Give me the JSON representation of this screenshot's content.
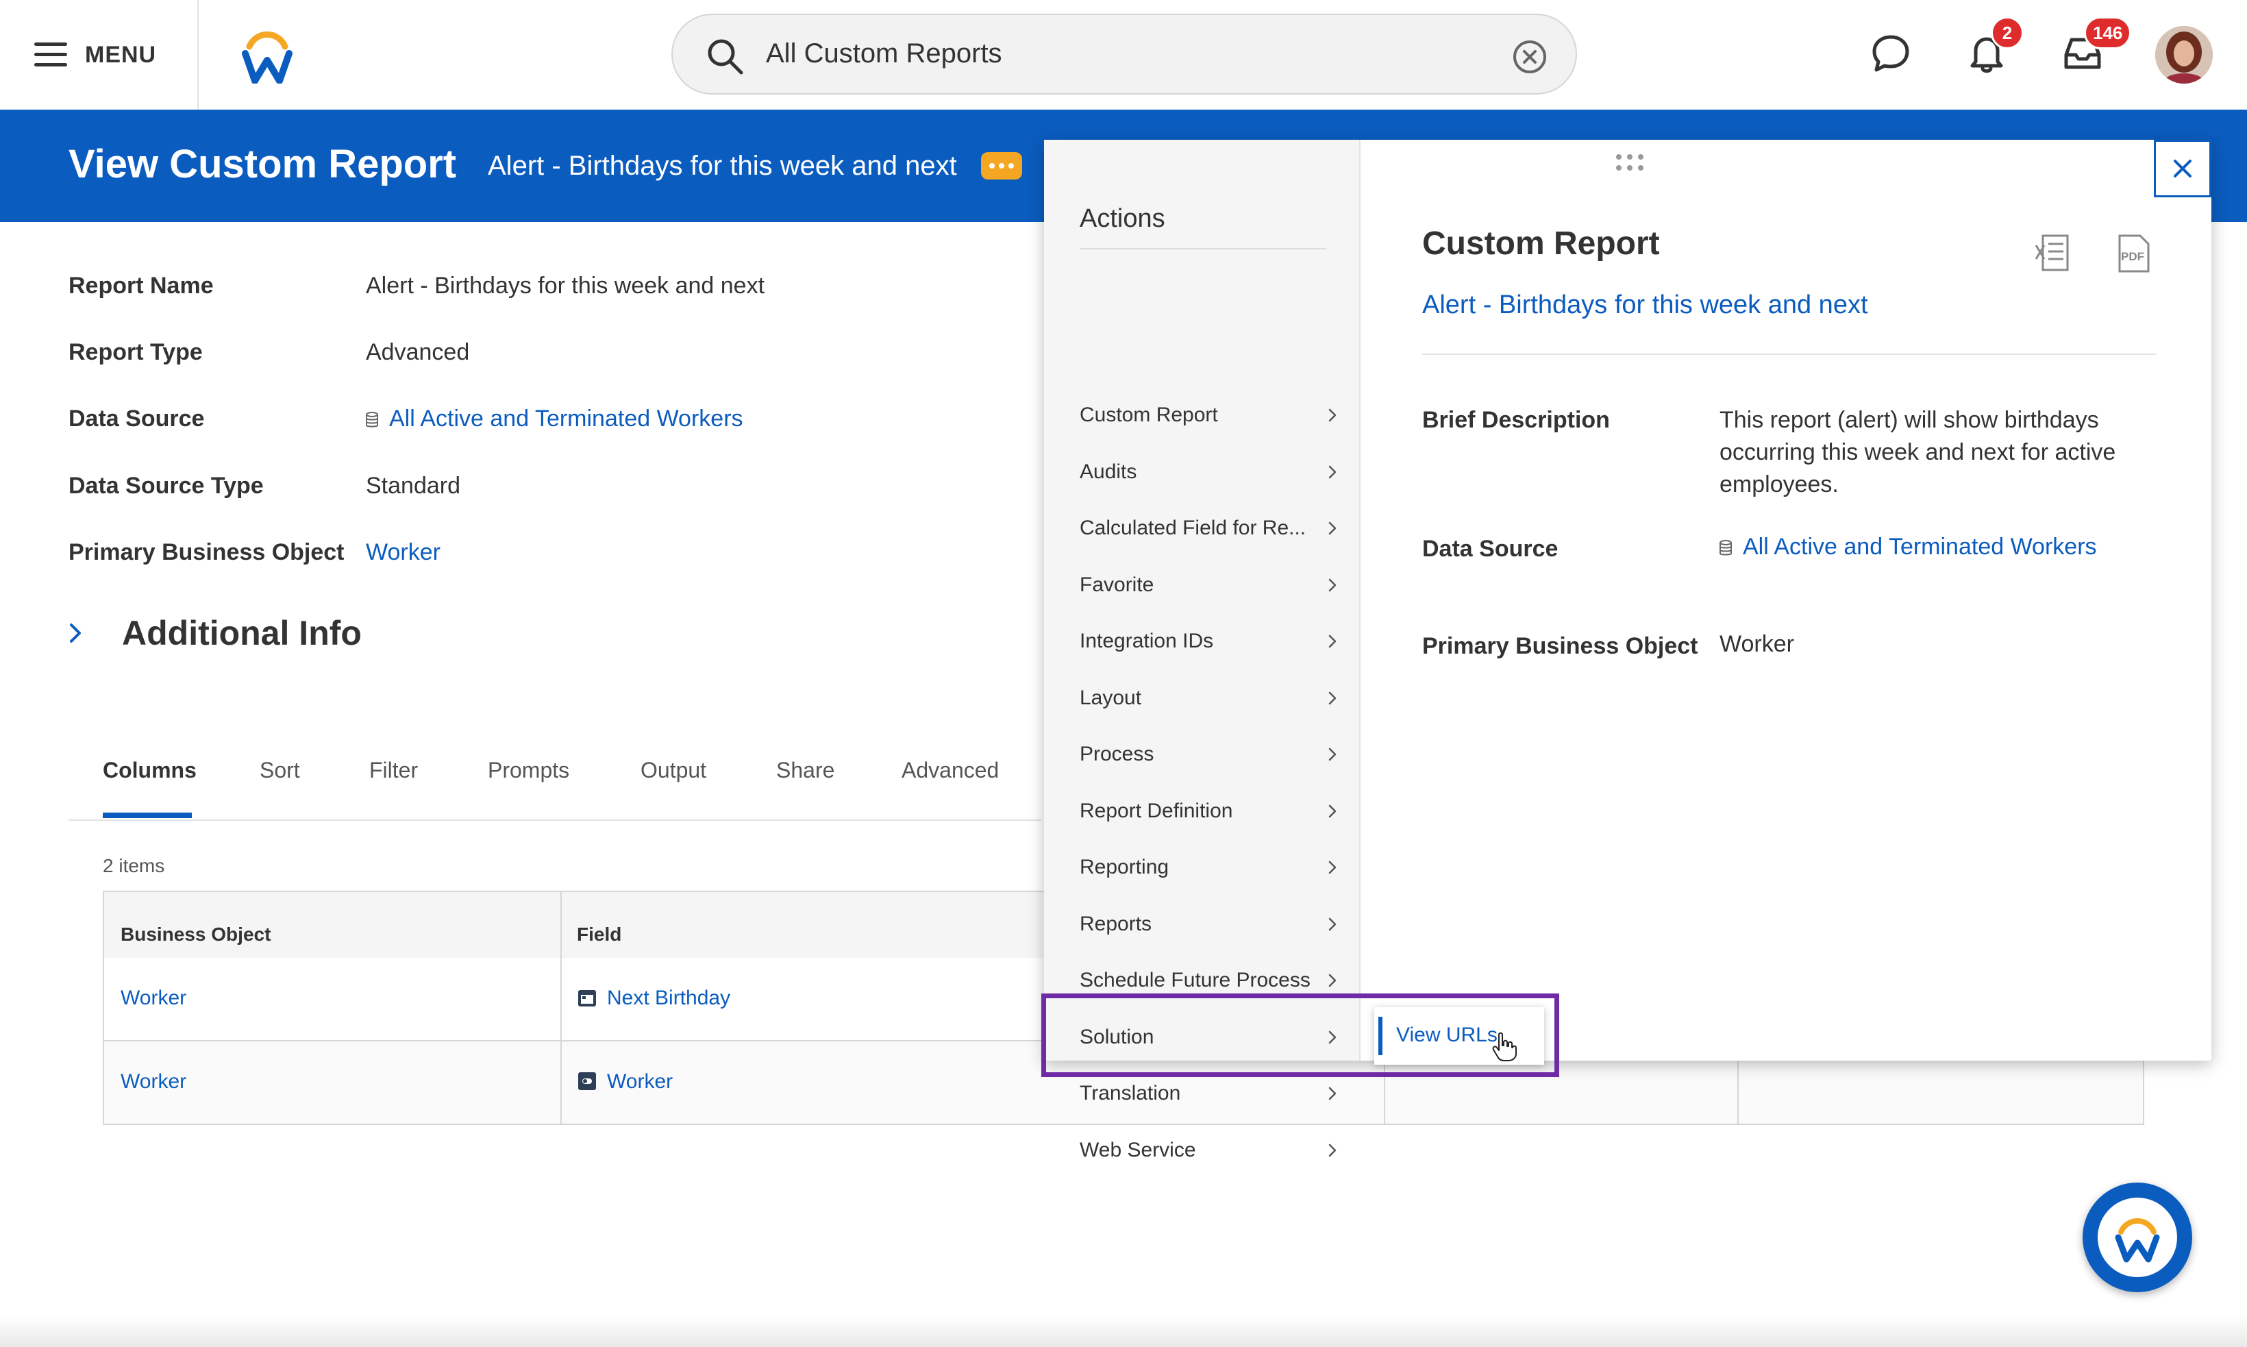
{
  "topbar": {
    "menu_label": "MENU",
    "search_value": "All Custom Reports",
    "notifications_count": "2",
    "inbox_count": "146"
  },
  "header": {
    "title": "View Custom Report",
    "subtitle": "Alert - Birthdays for this week and next"
  },
  "fields": [
    {
      "label": "Report Name",
      "value": "Alert - Birthdays for this week and next"
    },
    {
      "label": "Report Type",
      "value": "Advanced"
    },
    {
      "label": "Data Source",
      "value": "All Active and Terminated Workers"
    },
    {
      "label": "Data Source Type",
      "value": "Standard"
    },
    {
      "label": "Primary Business Object",
      "value": "Worker"
    }
  ],
  "additional_info": "Additional Info",
  "tabs": [
    "Columns",
    "Sort",
    "Filter",
    "Prompts",
    "Output",
    "Share",
    "Advanced"
  ],
  "items_count": "2 items",
  "grid": {
    "headers": [
      "Business Object",
      "Field"
    ],
    "rows": [
      {
        "business_object": "Worker",
        "field": "Next Birthday"
      },
      {
        "business_object": "Worker",
        "field": "Worker"
      }
    ]
  },
  "popup": {
    "actions_title": "Actions",
    "actions": [
      "Custom Report",
      "Audits",
      "Calculated Field for Re...",
      "Favorite",
      "Integration IDs",
      "Layout",
      "Process",
      "Report Definition",
      "Reporting",
      "Reports",
      "Schedule Future Process",
      "Solution",
      "Translation",
      "Web Service"
    ],
    "submenu_item": "View URLs",
    "details_title": "Custom Report",
    "details_link": "Alert - Birthdays for this week and next",
    "brief_description_label": "Brief Description",
    "brief_description": "This report (alert) will show birthdays occurring this week and next for active employees.",
    "data_source_label": "Data Source",
    "data_source": "All Active and Terminated Workers",
    "pbo_label": "Primary Business Object",
    "pbo": "Worker"
  },
  "colors": {
    "brand_blue": "#0b5cbf",
    "highlight_purple": "#6f2ba6",
    "badge_red": "#de2c2c",
    "related_actions_orange": "#f5a623"
  }
}
